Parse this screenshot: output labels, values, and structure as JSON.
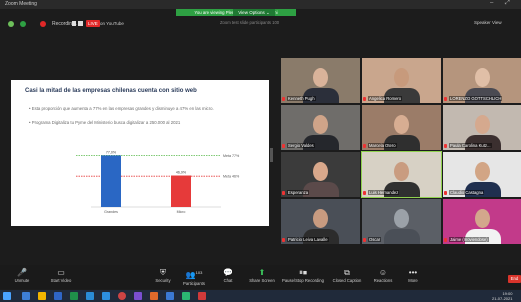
{
  "window": {
    "title": "Zoom Meeting",
    "minimize": "–",
    "maximize": "⤢"
  },
  "banner": {
    "text": "You are viewing Plena Sesión ICS Canacmi",
    "view_options": "View Options ⌄"
  },
  "recording": {
    "label": "Recording...",
    "live_badge": "LIVE",
    "live_platform": "on YouTube"
  },
  "status_line": "Zoom test slide participants 100",
  "speaker_view": "Speaker View",
  "slide": {
    "title": "Casi la mitad de las empresas chilenas cuenta con sitio web",
    "bullets": [
      "Esta proporción que aumenta a 77% en las empresas grandes y disminuye a 47% en las micro.",
      "Programa Digitaliza tu Pyme del Ministerio busca digitalizar a 250.000 al 2021"
    ]
  },
  "chart_data": {
    "type": "bar",
    "categories": [
      "Grandes",
      "Micro"
    ],
    "values": [
      77,
      47
    ],
    "colors": [
      "#2a67c4",
      "#e63a3a"
    ],
    "value_labels": [
      "77,0%",
      "46,9%"
    ],
    "reference_lines": [
      {
        "label": "Meta 77%",
        "value": 77,
        "color": "#56b948"
      },
      {
        "label": "Meta 46%",
        "value": 46,
        "color": "#e63a3a"
      }
    ],
    "ylim": [
      0,
      100
    ]
  },
  "participants": [
    {
      "name": "Kenneth Pugh",
      "bg": "#8a7b6a",
      "skin": "#d9b39a",
      "shirt": "#2b2f3a"
    },
    {
      "name": "Angelica Romero",
      "bg": "#c9a68d",
      "skin": "#c79a7c",
      "shirt": "#3a3a3a"
    },
    {
      "name": "LORENZO GOTTSCHLICH",
      "bg": "#b5957d",
      "skin": "#e0bfa7",
      "shirt": "#4a4a52"
    },
    {
      "name": "Sergio Valdes",
      "bg": "#6f6d6a",
      "skin": "#cfa489",
      "shirt": "#25272c"
    },
    {
      "name": "Marcela Otero",
      "bg": "#9b7c68",
      "skin": "#d7ad92",
      "shirt": "#2f2f2f"
    },
    {
      "name": "Paula Carolina Kutz...",
      "bg": "#c2b9b0",
      "skin": "#d5a98e",
      "shirt": "#3b2f2f"
    },
    {
      "name": "Esperanza",
      "bg": "#3b3b3b",
      "skin": "#d9a88b",
      "shirt": "#5b4a4a"
    },
    {
      "name": "Luis Hernandez",
      "bg": "#d7d1c5",
      "skin": "#c99c80",
      "shirt": "#303030",
      "active": true
    },
    {
      "name": "Claudio Castagna",
      "bg": "#e6e6e6",
      "skin": "#d2a585",
      "shirt": "#1f2f4f"
    },
    {
      "name": "Patricio Leiva Lavalle",
      "bg": "#4a4f57",
      "skin": "#c89b80",
      "shirt": "#2c2c2c"
    },
    {
      "name": "Oscar",
      "bg": "#5b5f66",
      "skin": "#9ba1a8",
      "shirt": "#4a4f57"
    },
    {
      "name": "Jaime (moviendose)",
      "bg": "#c23a8a",
      "skin": "#d3a78c",
      "shirt": "#f2f2f2"
    }
  ],
  "toolbar": {
    "unmute": "Unmute",
    "start_video": "Start Video",
    "security": "Security",
    "participants": "Participants",
    "participants_count": "103",
    "chat": "Chat",
    "share_screen": "Share Screen",
    "pause_stop_recording": "Pause/Stop Recording",
    "closed_caption": "Closed Caption",
    "reactions": "Reactions",
    "more": "More",
    "end": "End"
  },
  "taskbar": {
    "time": "19:00",
    "date": "21-07-2021"
  }
}
